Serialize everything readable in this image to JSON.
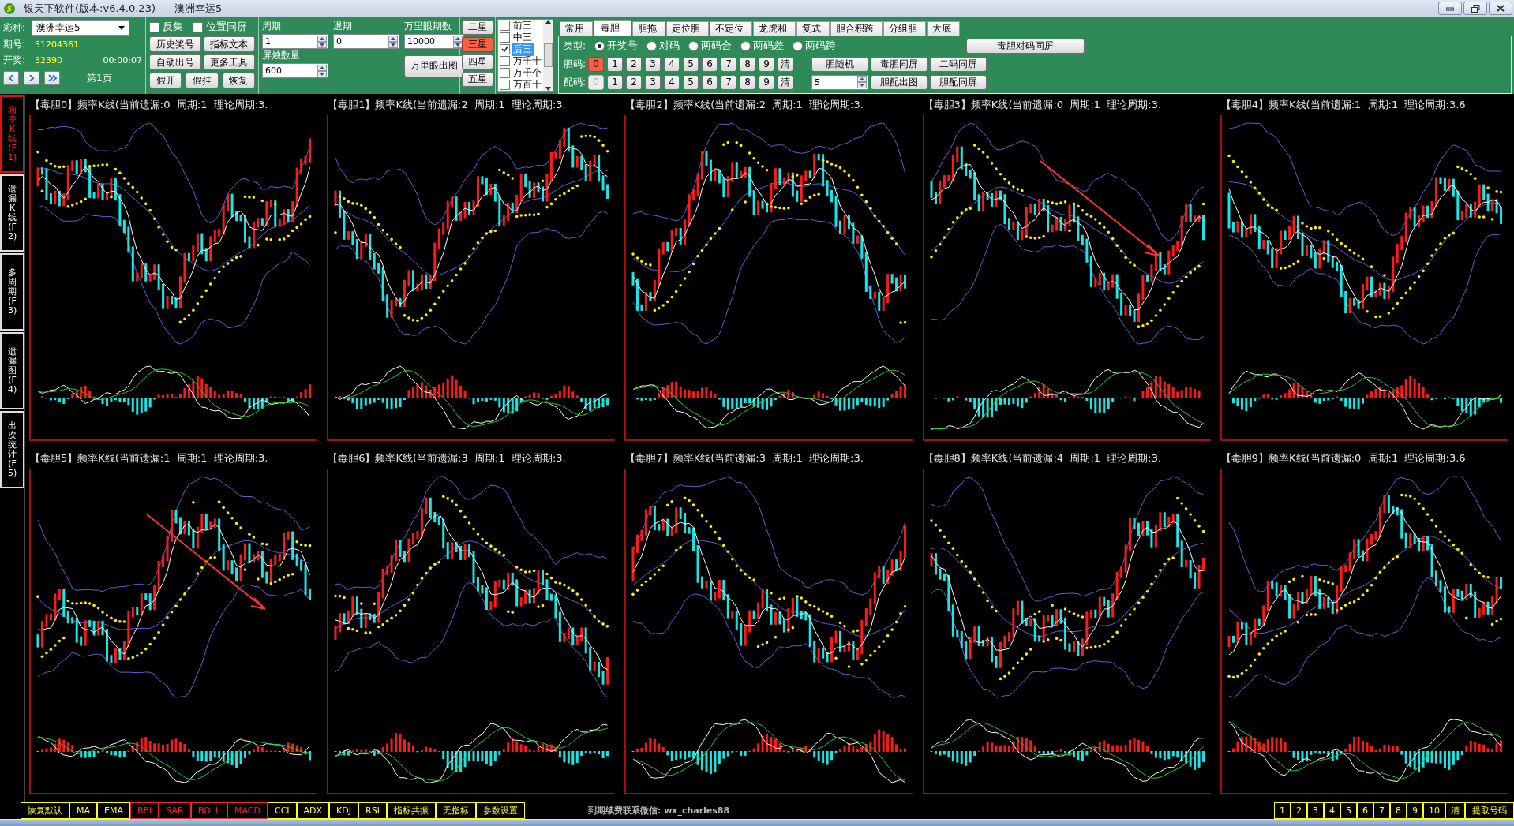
{
  "window": {
    "title": "银天下软件(版本:v6.4.0.23)",
    "subtitle": "澳洲幸运5"
  },
  "lottery": {
    "label": "彩种:",
    "value": "澳洲幸运5"
  },
  "issue": {
    "label": "期号:",
    "value": "51204361"
  },
  "draw": {
    "label": "开奖:",
    "value": "32390",
    "time": "00:00:07"
  },
  "page_label": "第1页",
  "checkboxes": [
    {
      "label": "反集",
      "checked": false
    },
    {
      "label": "位置同屏",
      "checked": false
    }
  ],
  "tool_buttons": [
    "历史奖号",
    "指标文本",
    "自动出号",
    "更多工具"
  ],
  "small_buttons": [
    "假开",
    "假挂",
    "恢复"
  ],
  "spinners": [
    {
      "label": "周期",
      "value": "1"
    },
    {
      "label": "退期",
      "value": "0"
    },
    {
      "label": "万里眼期数",
      "value": "10000"
    },
    {
      "label": "屏烛数量",
      "value": "600"
    }
  ],
  "wanliyan_button": "万里眼出图",
  "star_buttons": [
    {
      "label": "二星",
      "selected": false
    },
    {
      "label": "三星",
      "selected": true
    },
    {
      "label": "四星",
      "selected": false
    },
    {
      "label": "五星",
      "selected": false
    }
  ],
  "positions": [
    {
      "label": "前三",
      "checked": false,
      "selected": false
    },
    {
      "label": "中三",
      "checked": false,
      "selected": false
    },
    {
      "label": "后三",
      "checked": true,
      "selected": true
    },
    {
      "label": "万千十",
      "checked": false,
      "selected": false
    },
    {
      "label": "万千个",
      "checked": false,
      "selected": false
    },
    {
      "label": "万百十",
      "checked": false,
      "selected": false
    }
  ],
  "tabs": [
    {
      "label": "常用",
      "selected": false
    },
    {
      "label": "毒胆",
      "selected": true
    },
    {
      "label": "胆拖",
      "selected": false
    },
    {
      "label": "定位胆",
      "selected": false
    },
    {
      "label": "不定位",
      "selected": false
    },
    {
      "label": "龙虎和",
      "selected": false
    },
    {
      "label": "复式",
      "selected": false
    },
    {
      "label": "胆合积跨",
      "selected": false
    },
    {
      "label": "分组胆",
      "selected": false
    },
    {
      "label": "大底",
      "selected": false
    }
  ],
  "type_label": "类型:",
  "types": [
    {
      "label": "开奖号",
      "selected": true
    },
    {
      "label": "对码",
      "selected": false
    },
    {
      "label": "两码合",
      "selected": false
    },
    {
      "label": "两码差",
      "selected": false
    },
    {
      "label": "两码跨",
      "selected": false
    }
  ],
  "dan_label": "胆码:",
  "dan_digits": [
    {
      "label": "0",
      "selected": true,
      "disabled": false
    },
    {
      "label": "1",
      "selected": false,
      "disabled": false
    },
    {
      "label": "2",
      "selected": false,
      "disabled": false
    },
    {
      "label": "3",
      "selected": false,
      "disabled": false
    },
    {
      "label": "4",
      "selected": false,
      "disabled": false
    },
    {
      "label": "5",
      "selected": false,
      "disabled": false
    },
    {
      "label": "6",
      "selected": false,
      "disabled": false
    },
    {
      "label": "7",
      "selected": false,
      "disabled": false
    },
    {
      "label": "8",
      "selected": false,
      "disabled": false
    },
    {
      "label": "9",
      "selected": false,
      "disabled": false
    }
  ],
  "dan_clear": "清",
  "pei_label": "配码:",
  "pei_digits": [
    {
      "label": "0",
      "selected": false,
      "disabled": true
    },
    {
      "label": "1",
      "selected": false,
      "disabled": false
    },
    {
      "label": "2",
      "selected": false,
      "disabled": false
    },
    {
      "label": "3",
      "selected": false,
      "disabled": false
    },
    {
      "label": "4",
      "selected": false,
      "disabled": false
    },
    {
      "label": "5",
      "selected": false,
      "disabled": false
    },
    {
      "label": "6",
      "selected": false,
      "disabled": false
    },
    {
      "label": "7",
      "selected": false,
      "disabled": false
    },
    {
      "label": "8",
      "selected": false,
      "disabled": false
    },
    {
      "label": "9",
      "selected": false,
      "disabled": false
    }
  ],
  "pei_clear": "清",
  "pei_count": "5",
  "top_action": "毒胆对码同屏",
  "row1_actions": [
    "胆随机",
    "毒胆同屏",
    "二码同屏"
  ],
  "row2_actions": [
    "胆配出图",
    "胆配同屏"
  ],
  "sidebar": [
    {
      "label": "频率K线(F1)",
      "selected": true
    },
    {
      "label": "遗漏K线(F2)",
      "selected": false
    },
    {
      "label": "多周期(F3)",
      "selected": false
    },
    {
      "label": "遗漏图(F4)",
      "selected": false
    },
    {
      "label": "出次统计(F5)",
      "selected": false
    }
  ],
  "panels": [
    {
      "title": "【毒胆0】频率K线(当前遗漏:0  周期:1  理论周期:3."
    },
    {
      "title": "【毒胆1】频率K线(当前遗漏:2  周期:1  理论周期:3."
    },
    {
      "title": "【毒胆2】频率K线(当前遗漏:2  周期:1  理论周期:3."
    },
    {
      "title": "【毒胆3】频率K线(当前遗漏:0  周期:1  理论周期:3.",
      "arrow": true
    },
    {
      "title": "【毒胆4】频率K线(当前遗漏:1  周期:1  理论周期:3.6"
    },
    {
      "title": "【毒胆5】频率K线(当前遗漏:1  周期:1  理论周期:3.",
      "arrow": true
    },
    {
      "title": "【毒胆6】频率K线(当前遗漏:3  周期:1  理论周期:3."
    },
    {
      "title": "【毒胆7】频率K线(当前遗漏:3  周期:1  理论周期:3."
    },
    {
      "title": "【毒胆8】频率K线(当前遗漏:4  周期:1  理论周期:3."
    },
    {
      "title": "【毒胆9】频率K线(当前遗漏:0  周期:1  理论周期:3.6"
    }
  ],
  "indicators": [
    {
      "label": "恢复默认",
      "active": false
    },
    {
      "label": "MA",
      "active": false
    },
    {
      "label": "EMA",
      "active": false
    },
    {
      "label": "BBI",
      "active": true
    },
    {
      "label": "SAR",
      "active": true
    },
    {
      "label": "BOLL",
      "active": true
    },
    {
      "label": "MACD",
      "active": true
    },
    {
      "label": "CCI",
      "active": false
    },
    {
      "label": "ADX",
      "active": false
    },
    {
      "label": "KDJ",
      "active": false
    },
    {
      "label": "RSI",
      "active": false
    },
    {
      "label": "指标共振",
      "active": false
    },
    {
      "label": "无指标",
      "active": false
    },
    {
      "label": "参数设置",
      "active": false
    }
  ],
  "notice": "到期续费联系微信: wx_charles88",
  "page_buttons": [
    "1",
    "2",
    "3",
    "4",
    "5",
    "6",
    "7",
    "8",
    "9",
    "10",
    "清"
  ],
  "extract_button": "提取号码"
}
